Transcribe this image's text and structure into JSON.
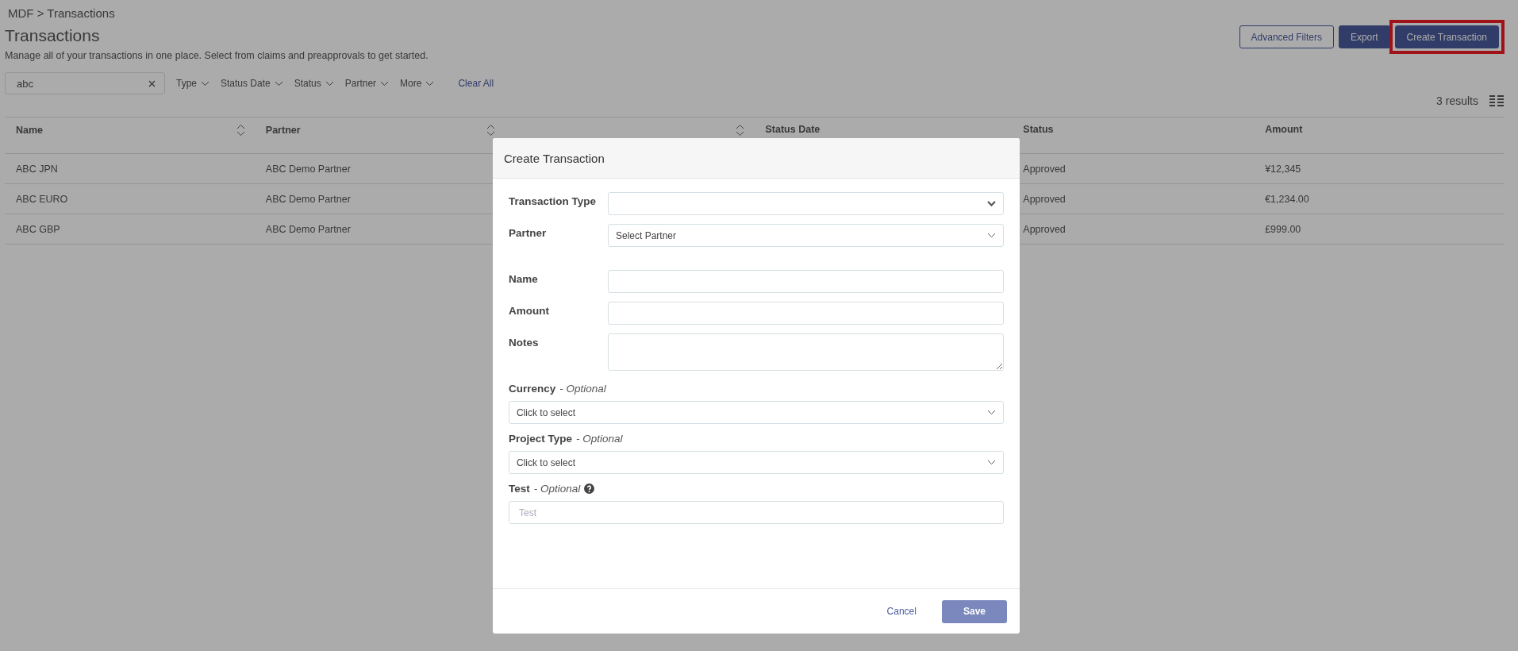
{
  "breadcrumb": "MDF > Transactions",
  "title": "Transactions",
  "description": "Manage all of your transactions in one place. Select from claims and preapprovals to get started.",
  "actions": [
    {
      "label": "Advanced Filters",
      "kind": "outline",
      "highlighted": false
    },
    {
      "label": "Export",
      "kind": "primary",
      "highlighted": false
    },
    {
      "label": "Create Transaction",
      "kind": "primary",
      "highlighted": true
    }
  ],
  "search": {
    "value": "abc"
  },
  "filters": [
    {
      "label": "Type"
    },
    {
      "label": "Status Date"
    },
    {
      "label": "Status"
    },
    {
      "label": "Partner"
    },
    {
      "label": "More"
    }
  ],
  "clear_all": "Clear All",
  "results_count": "3 results",
  "table": {
    "columns": [
      {
        "label": "Name",
        "sortable": true
      },
      {
        "label": "Partner",
        "sortable": true
      },
      {
        "sortable": true
      },
      {
        "label": "Status Date",
        "sortable": false
      },
      {
        "label": "Status",
        "sortable": false
      },
      {
        "label": "Amount",
        "sortable": false
      }
    ],
    "rows": [
      {
        "name": "ABC JPN",
        "partner": "ABC Demo Partner",
        "status": "Approved",
        "amount": "¥12,345"
      },
      {
        "name": "ABC EURO",
        "partner": "ABC Demo Partner",
        "status": "Approved",
        "amount": "€1,234.00"
      },
      {
        "name": "ABC GBP",
        "partner": "ABC Demo Partner",
        "status": "Approved",
        "amount": "£999.00"
      }
    ]
  },
  "modal": {
    "title": "Create Transaction",
    "fields": [
      {
        "label": "Transaction Type",
        "kind": "select"
      },
      {
        "label": "Partner",
        "kind": "dropdown",
        "placeholder": "Select Partner"
      },
      {
        "label": "Name",
        "kind": "text"
      },
      {
        "label": "Amount",
        "kind": "text"
      },
      {
        "label": "Notes",
        "kind": "textarea"
      },
      {
        "label": "Currency",
        "optional_note": "- Optional",
        "kind": "dropdown",
        "placeholder": "Click to select"
      },
      {
        "label": "Project Type",
        "optional_note": "- Optional",
        "kind": "dropdown",
        "placeholder": "Click to select"
      },
      {
        "label": "Test",
        "optional_note": "- Optional",
        "help": true,
        "kind": "text",
        "placeholder": "Test"
      }
    ],
    "cancel": "Cancel",
    "save": {
      "label": "Save",
      "disabled": true
    }
  }
}
